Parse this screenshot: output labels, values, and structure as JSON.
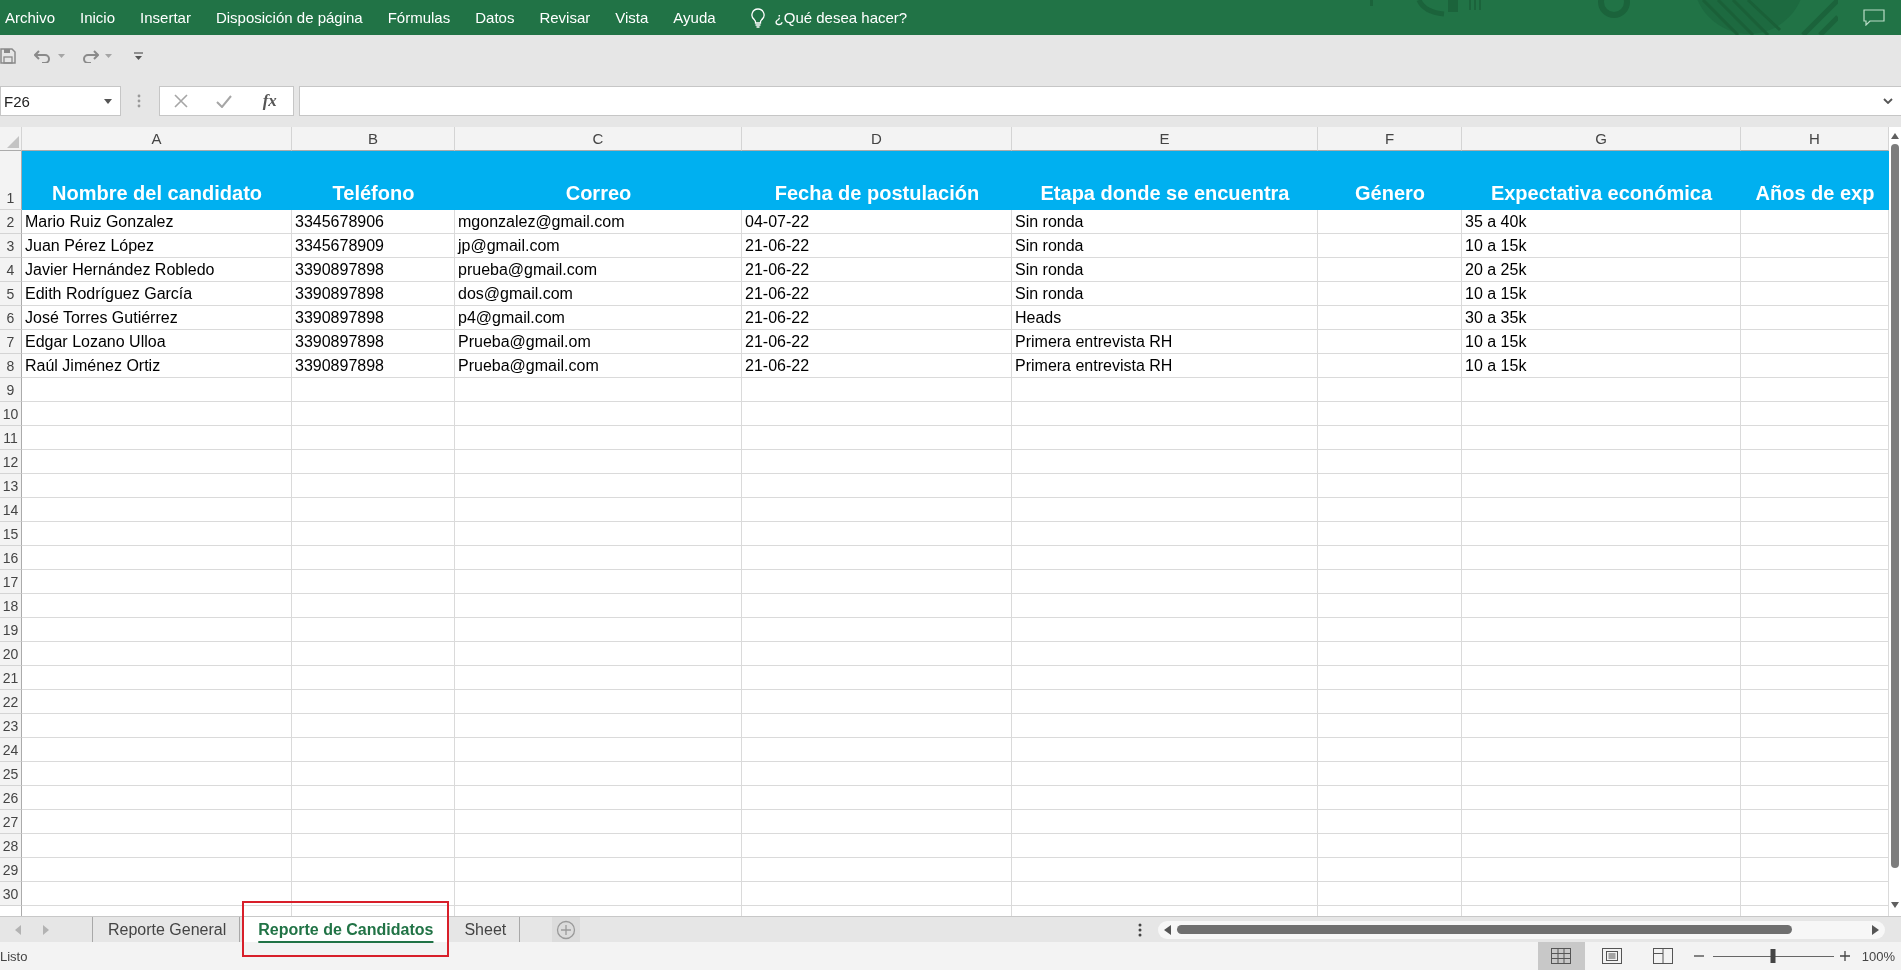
{
  "ribbon": {
    "tabs": [
      "Archivo",
      "Inicio",
      "Insertar",
      "Disposición de página",
      "Fórmulas",
      "Datos",
      "Revisar",
      "Vista",
      "Ayuda"
    ],
    "tell_me": "¿Qué desea hacer?"
  },
  "formula_bar": {
    "name_box": "F26",
    "function_button": "fx"
  },
  "sheet": {
    "columns": [
      "A",
      "B",
      "C",
      "D",
      "E",
      "F",
      "G",
      "H"
    ],
    "rows": [
      {
        "number": "1",
        "kind": "header",
        "cells": [
          "Nombre del candidato",
          "Teléfono",
          "Correo",
          "Fecha de postulación",
          "Etapa donde se encuentra",
          "Género",
          "Expectativa económica",
          "Años de exp"
        ]
      },
      {
        "number": "2",
        "kind": "data",
        "cells": [
          "Mario Ruiz Gonzalez",
          "3345678906",
          "mgonzalez@gmail.com",
          "04-07-22",
          "Sin ronda",
          null,
          "35 a 40k"
        ]
      },
      {
        "number": "3",
        "kind": "data",
        "cells": [
          "Juan Pérez López",
          "3345678909",
          "jp@gmail.com",
          "21-06-22",
          "Sin ronda",
          null,
          "10 a 15k"
        ]
      },
      {
        "number": "4",
        "kind": "data",
        "cells": [
          "Javier Hernández Robledo",
          "3390897898",
          "prueba@gmail.com",
          "21-06-22",
          "Sin ronda",
          null,
          "20 a 25k"
        ]
      },
      {
        "number": "5",
        "kind": "data",
        "cells": [
          "Edith Rodríguez García",
          "3390897898",
          "dos@gmail.com",
          "21-06-22",
          "Sin ronda",
          null,
          "10 a 15k"
        ]
      },
      {
        "number": "6",
        "kind": "data",
        "cells": [
          "José Torres Gutiérrez",
          "3390897898",
          "p4@gmail.com",
          "21-06-22",
          "Heads",
          null,
          "30 a 35k"
        ]
      },
      {
        "number": "7",
        "kind": "data",
        "cells": [
          "Edgar Lozano Ulloa",
          "3390897898",
          "Prueba@gmail.om",
          "21-06-22",
          "Primera entrevista RH",
          null,
          "10 a 15k"
        ]
      },
      {
        "number": "8",
        "kind": "data",
        "cells": [
          "Raúl Jiménez Ortiz",
          "3390897898",
          "Prueba@gmail.com",
          "21-06-22",
          "Primera entrevista RH",
          null,
          "10 a 15k"
        ]
      },
      {
        "number": "9",
        "kind": "data"
      },
      {
        "number": "10",
        "kind": "data"
      },
      {
        "number": "11",
        "kind": "data"
      },
      {
        "number": "12",
        "kind": "data"
      },
      {
        "number": "13",
        "kind": "data"
      },
      {
        "number": "14",
        "kind": "data"
      },
      {
        "number": "15",
        "kind": "data"
      },
      {
        "number": "16",
        "kind": "data"
      },
      {
        "number": "17",
        "kind": "data"
      },
      {
        "number": "18",
        "kind": "data"
      },
      {
        "number": "19",
        "kind": "data"
      },
      {
        "number": "20",
        "kind": "data"
      },
      {
        "number": "21",
        "kind": "data"
      },
      {
        "number": "22",
        "kind": "data"
      },
      {
        "number": "23",
        "kind": "data"
      },
      {
        "number": "24",
        "kind": "data"
      },
      {
        "number": "25",
        "kind": "data"
      },
      {
        "number": "26",
        "kind": "data"
      },
      {
        "number": "27",
        "kind": "data"
      },
      {
        "number": "28",
        "kind": "data"
      },
      {
        "number": "29",
        "kind": "data"
      },
      {
        "number": "30",
        "kind": "data"
      }
    ]
  },
  "sheet_tabs": [
    {
      "label": "Reporte General",
      "selected": false,
      "outlined": false
    },
    {
      "label": "Reporte de Candidatos",
      "selected": true,
      "outlined": true
    },
    {
      "label": "Sheet",
      "selected": false,
      "outlined": false
    }
  ],
  "status_bar": {
    "status": "Listo",
    "views": [
      {
        "kind": "normal",
        "selected": true
      },
      {
        "kind": "page_layout",
        "selected": false
      },
      {
        "kind": "page_break",
        "selected": false
      }
    ],
    "zoom": {
      "level": 0.5,
      "reading": "100%"
    }
  }
}
